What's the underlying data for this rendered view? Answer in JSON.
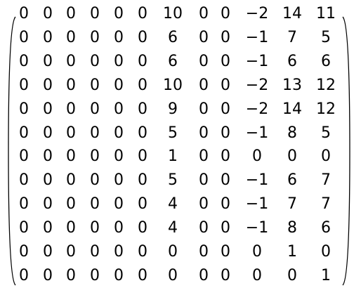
{
  "matrix": {
    "rows": [
      [
        "0",
        "0",
        "0",
        "0",
        "0",
        "0",
        "10",
        "0",
        "0",
        "−2",
        "14",
        "11"
      ],
      [
        "0",
        "0",
        "0",
        "0",
        "0",
        "0",
        "6",
        "0",
        "0",
        "−1",
        "7",
        "5"
      ],
      [
        "0",
        "0",
        "0",
        "0",
        "0",
        "0",
        "6",
        "0",
        "0",
        "−1",
        "6",
        "6"
      ],
      [
        "0",
        "0",
        "0",
        "0",
        "0",
        "0",
        "10",
        "0",
        "0",
        "−2",
        "13",
        "12"
      ],
      [
        "0",
        "0",
        "0",
        "0",
        "0",
        "0",
        "9",
        "0",
        "0",
        "−2",
        "14",
        "12"
      ],
      [
        "0",
        "0",
        "0",
        "0",
        "0",
        "0",
        "5",
        "0",
        "0",
        "−1",
        "8",
        "5"
      ],
      [
        "0",
        "0",
        "0",
        "0",
        "0",
        "0",
        "1",
        "0",
        "0",
        "0",
        "0",
        "0"
      ],
      [
        "0",
        "0",
        "0",
        "0",
        "0",
        "0",
        "5",
        "0",
        "0",
        "−1",
        "6",
        "7"
      ],
      [
        "0",
        "0",
        "0",
        "0",
        "0",
        "0",
        "4",
        "0",
        "0",
        "−1",
        "7",
        "7"
      ],
      [
        "0",
        "0",
        "0",
        "0",
        "0",
        "0",
        "4",
        "0",
        "0",
        "−1",
        "8",
        "6"
      ],
      [
        "0",
        "0",
        "0",
        "0",
        "0",
        "0",
        "0",
        "0",
        "0",
        "0",
        "1",
        "0"
      ],
      [
        "0",
        "0",
        "0",
        "0",
        "0",
        "0",
        "0",
        "0",
        "0",
        "0",
        "0",
        "1"
      ]
    ]
  }
}
